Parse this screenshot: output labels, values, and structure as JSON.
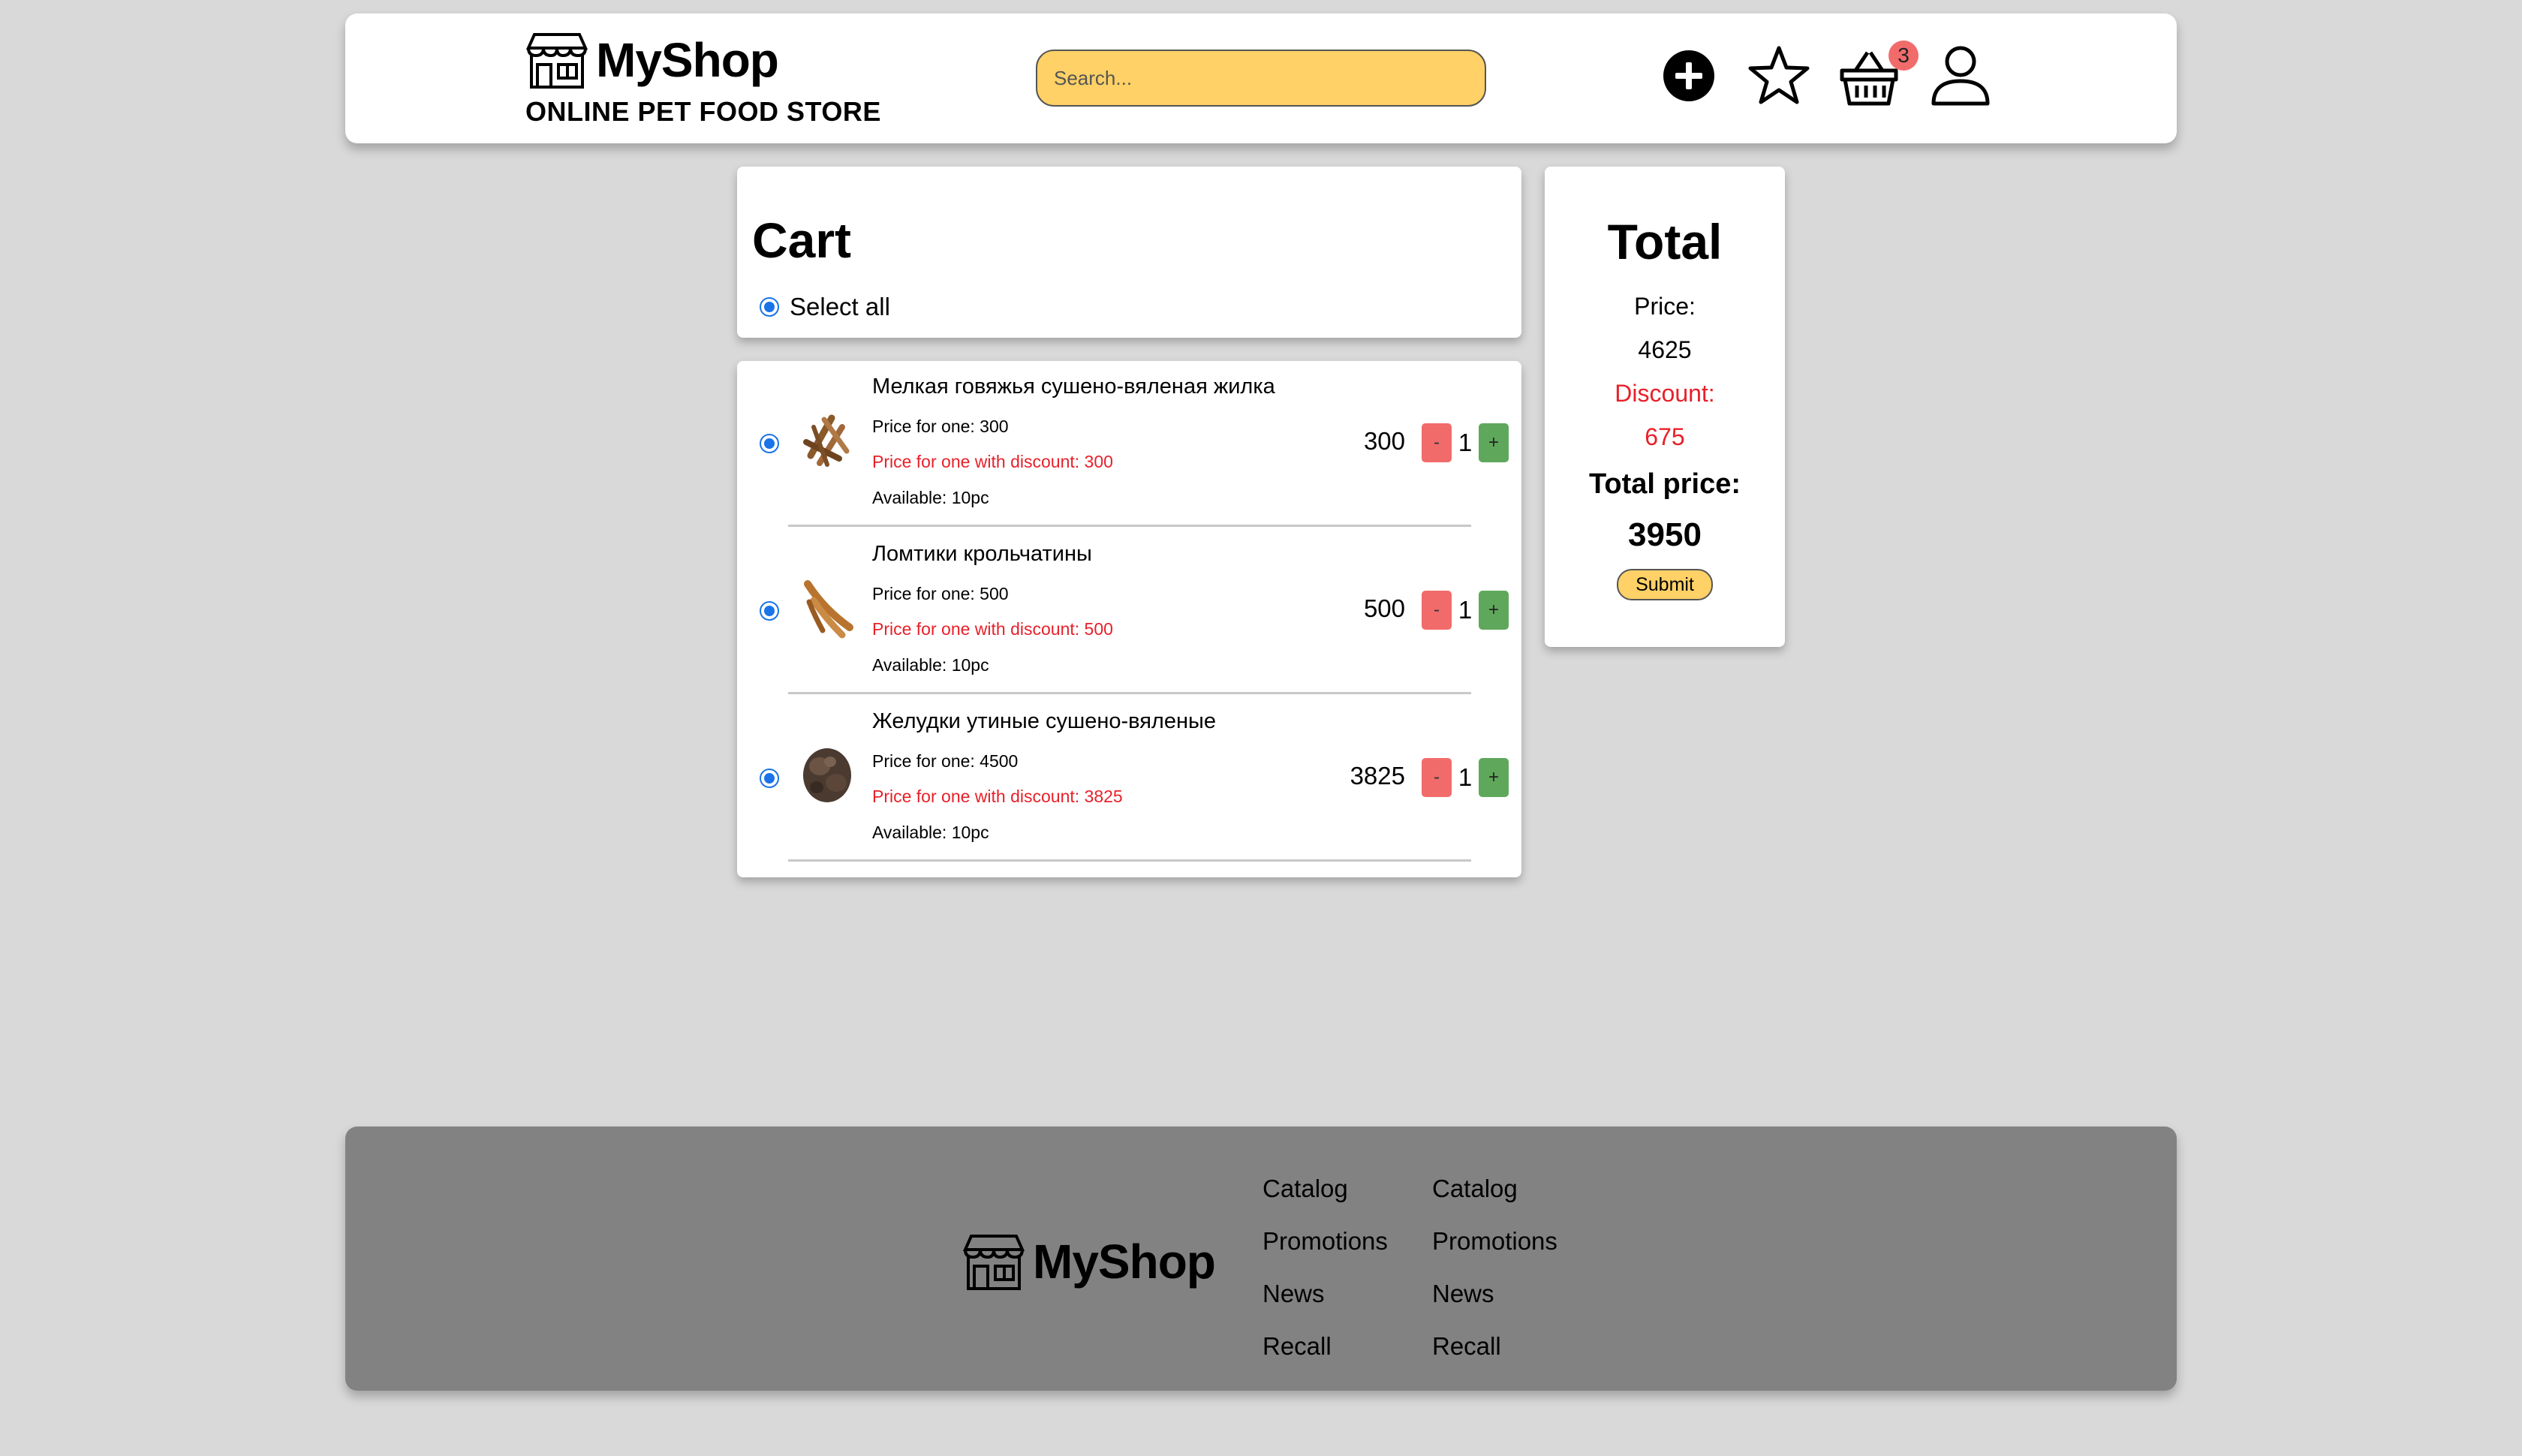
{
  "header": {
    "brand": "MyShop",
    "subtitle": "ONLINE PET FOOD STORE",
    "search_placeholder": "Search...",
    "cart_count": "3",
    "icons": [
      "plus-circle-icon",
      "star-icon",
      "basket-icon",
      "user-icon"
    ]
  },
  "cart": {
    "title": "Cart",
    "select_all": "Select all",
    "items": [
      {
        "name": "Мелкая говяжья сушено-вяленая жилка",
        "price": "Price for one: 300",
        "discount_price": "Price for one with discount: 300",
        "available": "Available: 10pc",
        "sum": "300",
        "qty": "1",
        "minus": "-",
        "plus": "+"
      },
      {
        "name": "Ломтики крольчатины",
        "price": "Price for one: 500",
        "discount_price": "Price for one with discount: 500",
        "available": "Available: 10pc",
        "sum": "500",
        "qty": "1",
        "minus": "-",
        "plus": "+"
      },
      {
        "name": "Желудки утиные сушено-вяленые",
        "price": "Price for one: 4500",
        "discount_price": "Price for one with discount: 3825",
        "available": "Available: 10pc",
        "sum": "3825",
        "qty": "1",
        "minus": "-",
        "plus": "+"
      }
    ]
  },
  "total": {
    "title": "Total",
    "price_label": "Price:",
    "price_value": "4625",
    "discount_label": "Discount:",
    "discount_value": "675",
    "total_label": "Total price:",
    "total_value": "3950",
    "submit": "Submit"
  },
  "footer": {
    "brand": "MyShop",
    "col1": [
      "Catalog",
      "Promotions",
      "News",
      "Recall"
    ],
    "col2": [
      "Catalog",
      "Promotions",
      "News",
      "Recall"
    ]
  },
  "colors": {
    "accent": "#ffd166",
    "discount": "#e8202a",
    "minus": "#f26b6b",
    "plus": "#5fa85b",
    "footer": "#828282",
    "radio": "#1a73e8"
  }
}
